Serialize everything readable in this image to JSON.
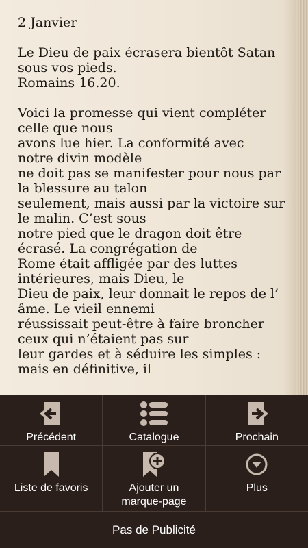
{
  "reader": {
    "lines": [
      "2 Janvier",
      "",
      "Le Dieu de paix écrasera bientôt Satan",
      "sous vos pieds.",
      "Romains 16.20.",
      "",
      "Voici la promesse qui vient compléter",
      "celle que nous",
      " avons lue hier. La conformité avec",
      "notre divin modèle",
      "ne doit pas se manifester pour nous par",
      "la blessure au talon",
      "seulement, mais aussi par la victoire sur",
      " le malin. C’est sous",
      "notre pied que le dragon doit être",
      "écrasé. La congrégation de",
      "Rome était affligée par des luttes",
      "intérieures, mais Dieu, le",
      "Dieu de paix, leur donnait le repos de l’",
      "âme. Le vieil ennemi",
      "réussissait peut-être à faire broncher",
      "ceux qui n’étaient pas sur",
      "leur gardes et à séduire les simples :",
      "mais en définitive, il"
    ]
  },
  "menu": {
    "previous_label": "Précédent",
    "catalogue_label": "Catalogue",
    "next_label": "Prochain",
    "favorites_label": "Liste de favoris",
    "add_bookmark_label": "Ajouter un\nmarque-page",
    "more_label": "Plus",
    "no_ads_label": "Pas de Publicité"
  },
  "colors": {
    "page_bg": "#f1e9dc",
    "menu_bg": "#2a1f1b",
    "icon_color": "#c7b9ae",
    "text_color": "#1d1a16"
  },
  "icons": {
    "previous": "page-arrow-left-icon",
    "catalogue": "list-icon",
    "next": "page-arrow-right-icon",
    "favorites": "bookmark-icon",
    "add_bookmark": "bookmark-add-icon",
    "more": "chevron-down-circle-icon"
  }
}
